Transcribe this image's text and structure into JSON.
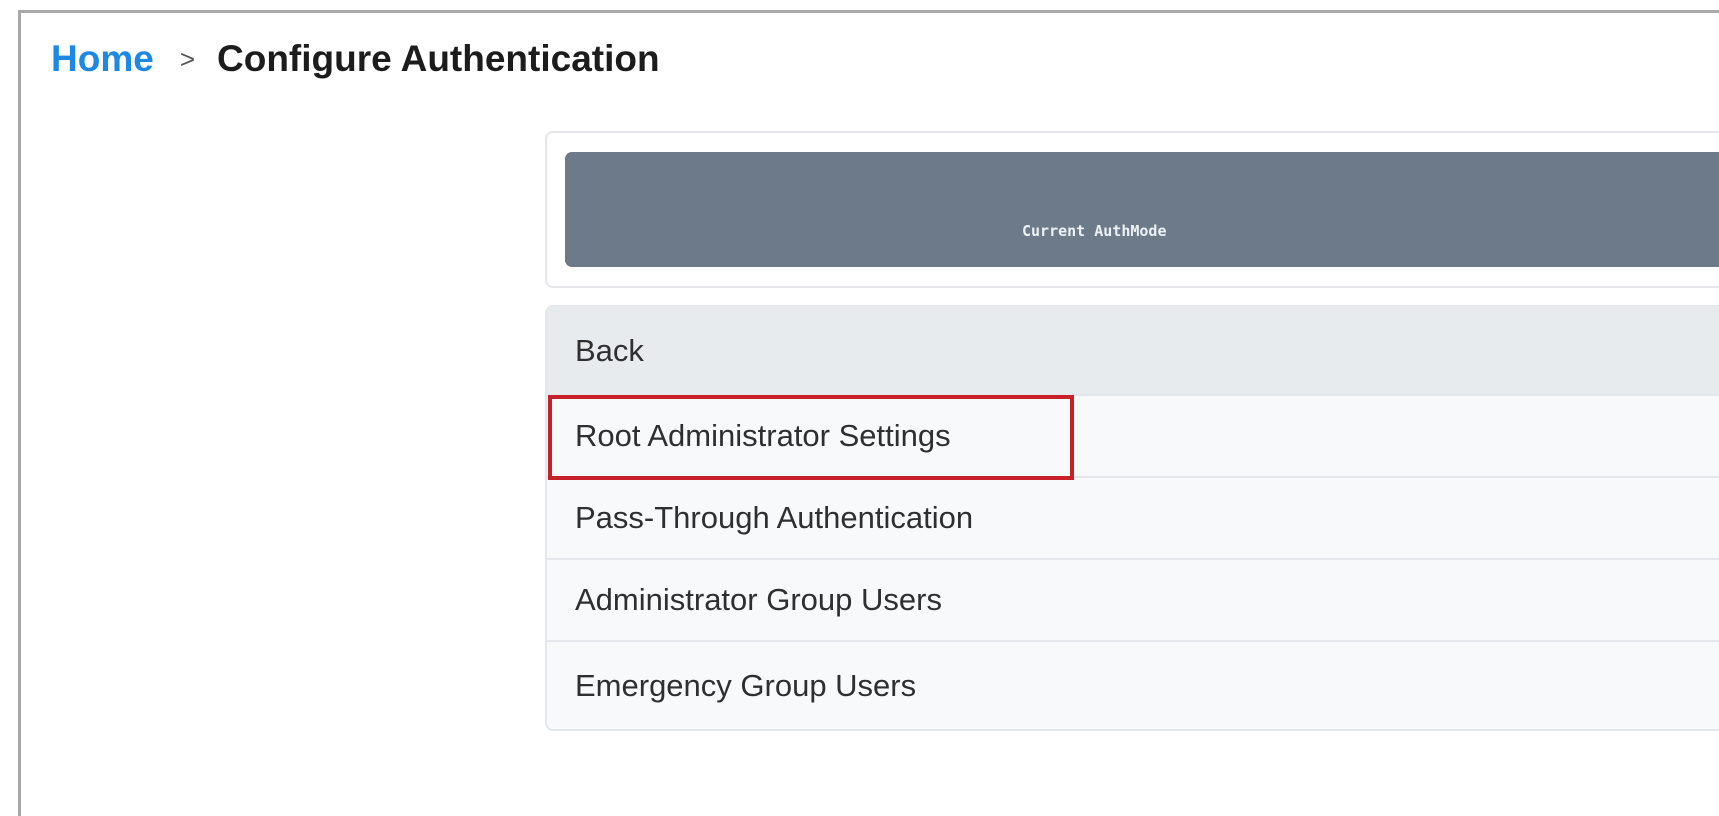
{
  "breadcrumb": {
    "home": "Home",
    "separator": ">",
    "current": "Configure Authentication"
  },
  "auth_mode": {
    "text": "Current AuthMode"
  },
  "menu": {
    "items": [
      {
        "label": "Back"
      },
      {
        "label": "Root Administrator Settings"
      },
      {
        "label": "Pass-Through Authentication"
      },
      {
        "label": "Administrator Group Users"
      },
      {
        "label": "Emergency Group Users"
      }
    ]
  },
  "colors": {
    "link": "#1e88e5",
    "banner": "#6c7a89",
    "highlight": "#c8202a",
    "back_row": "#e8ebee",
    "menu_bg": "#f8f9fa"
  }
}
